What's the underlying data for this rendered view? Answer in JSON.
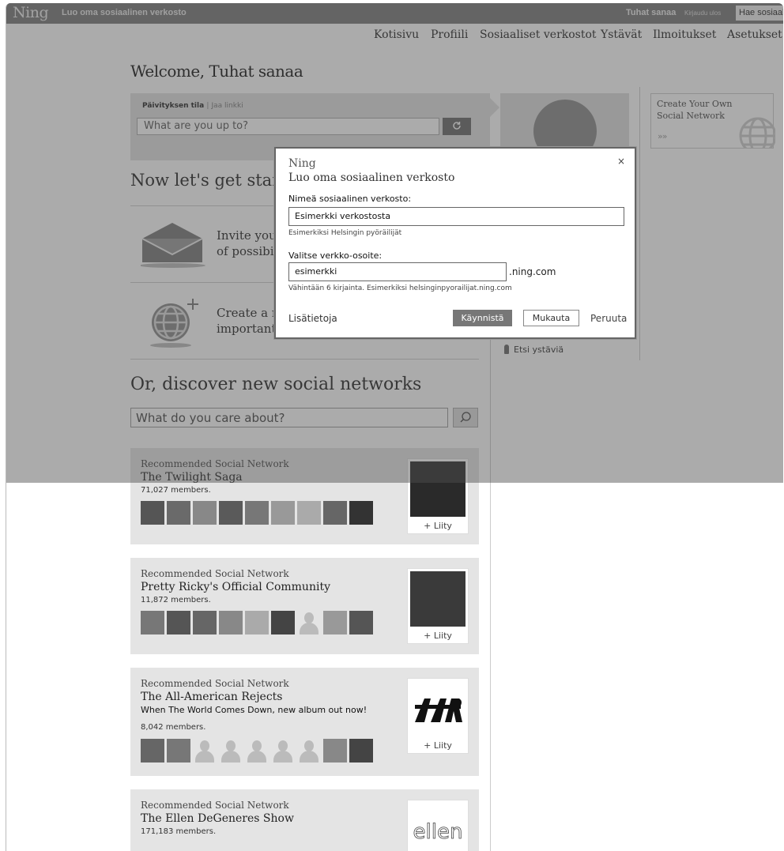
{
  "topbar": {
    "logo": "Ning",
    "create_network": "Luo oma sosiaalinen verkosto",
    "user": "Tuhat sanaa",
    "logout": "Kirjaudu ulos",
    "search_button": "Hae sosiaal"
  },
  "nav": [
    {
      "label": "Kotisivu"
    },
    {
      "label": "Profiili"
    },
    {
      "label": "Sosiaaliset verkostot"
    },
    {
      "label": "Ystävät"
    },
    {
      "label": "Ilmoitukset"
    },
    {
      "label": "Asetukset"
    }
  ],
  "welcome": "Welcome, Tuhat sanaa",
  "status": {
    "tab": "Päivityksen tila",
    "separator": "|",
    "share": "Jaa linkki",
    "placeholder": "What are you up to?"
  },
  "ad": {
    "title": "Create Your Own Social Network",
    "chevrons": "»»"
  },
  "getting_started": {
    "heading": "Now let's get started",
    "invite_text_1": "Invite your friends and explore a world",
    "invite_text_2": "of possibilities",
    "create_text_1": "Create a new social network for the",
    "create_text_2": "important things in your life"
  },
  "discover": {
    "heading": "Or, discover new social networks",
    "placeholder": "What do you care about?"
  },
  "networks": [
    {
      "rec": "Recommended Social Network",
      "name": "The Twilight Saga",
      "desc": "",
      "members": "71,027 members.",
      "join": "+ Liity"
    },
    {
      "rec": "Recommended Social Network",
      "name": "Pretty Ricky's Official Community",
      "desc": "",
      "members": "11,872 members.",
      "join": "+ Liity"
    },
    {
      "rec": "Recommended Social Network",
      "name": "The All-American Rejects",
      "desc": "When The World Comes Down, new album out now!",
      "members": "8,042 members.",
      "join": "+ Liity"
    },
    {
      "rec": "Recommended Social Network",
      "name": "The Ellen DeGeneres Show",
      "desc": "",
      "members": "171,183 members.",
      "join": ""
    }
  ],
  "sidebar": {
    "find_friends": "Etsi ystäviä"
  },
  "modal": {
    "brand": "Ning",
    "title": "Luo oma sosiaalinen verkosto",
    "close": "×",
    "name_label": "Nimeä sosiaalinen verkosto:",
    "name_value": "Esimerkki verkostosta",
    "name_hint": "Esimerkiksi Helsingin pyöräilijät",
    "url_label": "Valitse verkko-osoite:",
    "url_value": "esimerkki",
    "url_suffix": ".ning.com",
    "url_hint": "Vähintään 6 kirjainta. Esimerkiksi helsinginpyorailijat.ning.com",
    "more": "Lisätietoja",
    "start": "Käynnistä",
    "customize": "Mukauta",
    "cancel": "Peruuta"
  }
}
